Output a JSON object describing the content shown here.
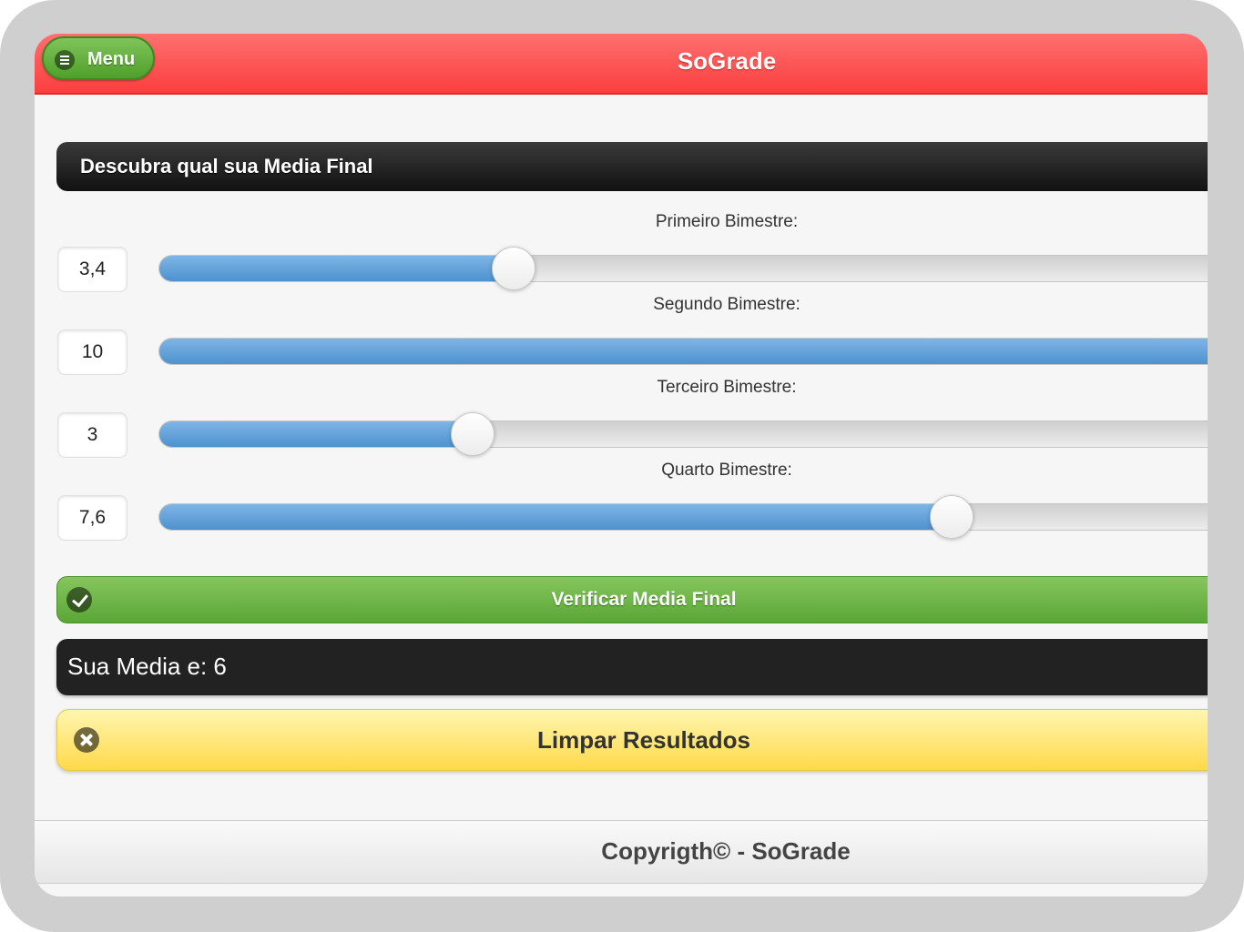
{
  "header": {
    "menu_label": "Menu",
    "title": "SoGrade"
  },
  "section": {
    "title": "Descubra qual sua Media Final"
  },
  "sliders": [
    {
      "label": "Primeiro Bimestre:",
      "value": "3,4",
      "numeric": 3.4,
      "max": 10
    },
    {
      "label": "Segundo Bimestre:",
      "value": "10",
      "numeric": 10,
      "max": 10
    },
    {
      "label": "Terceiro Bimestre:",
      "value": "3",
      "numeric": 3,
      "max": 10
    },
    {
      "label": "Quarto Bimestre:",
      "value": "7,6",
      "numeric": 7.6,
      "max": 10
    }
  ],
  "verify_button": {
    "label": "Verificar Media Final"
  },
  "result": {
    "text": "Sua Media e: 6"
  },
  "clear_button": {
    "label": "Limpar Resultados"
  },
  "footer": {
    "text": "Copyrigth© - SoGrade"
  },
  "colors": {
    "header": "#ff5252",
    "accent_green": "#5aa637",
    "slider_fill": "#4d92cf",
    "clear_yellow": "#ffd94a"
  },
  "icons": {
    "menu": "hamburger-icon",
    "verify": "check-icon",
    "clear": "close-icon"
  }
}
